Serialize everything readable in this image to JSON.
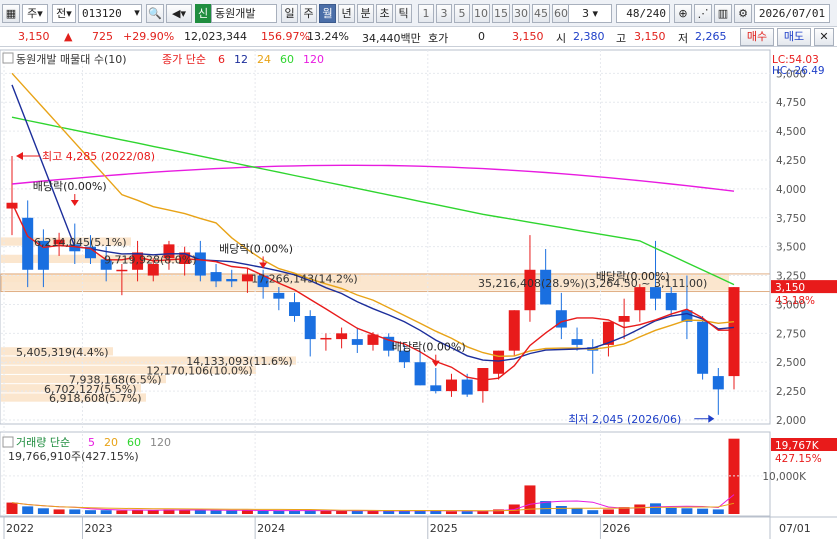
{
  "toolbar": {
    "chart_type_label": "주",
    "period_label": "전",
    "code": "013120",
    "badge": "신",
    "stock_name": "동원개발",
    "periods": [
      "일",
      "주",
      "월",
      "년",
      "분",
      "초",
      "틱"
    ],
    "active_period": "월",
    "intervals": [
      "1",
      "3",
      "5",
      "10",
      "15",
      "30",
      "45",
      "60"
    ],
    "interval_select": "3",
    "count": "48/240",
    "date": "2026/07/01"
  },
  "quote": {
    "price": "3,150",
    "change": "725",
    "change_pct": "+29.90%",
    "volume": "12,023,344",
    "vol_ratio": "156.97%",
    "turnover": "13.24%",
    "amount": "34,440백만",
    "hoga_label": "호가",
    "hoga_value": "0",
    "hoga_price": "3,150",
    "open_label": "시",
    "open": "2,380",
    "high_label": "고",
    "high": "3,150",
    "low_label": "저",
    "low": "2,265",
    "buy_label": "매수",
    "sell_label": "매도"
  },
  "price_panel": {
    "series_label": "동원개발 매물대 수(10)",
    "ma_label": "종가 단순",
    "ma_periods": [
      "6",
      "12",
      "24",
      "60",
      "120"
    ],
    "ma_colors": [
      "#e81b1b",
      "#1c2e9b",
      "#e8a317",
      "#2fd52f",
      "#e81be0"
    ],
    "lc": "LC:54.03",
    "hc": "HC:-26.49",
    "current_price_tag": "3,150",
    "current_pct_tag": "43.18%",
    "high_annotation": "최고 4,285 (2022/08)",
    "low_annotation": "최저 2,045 (2026/06)",
    "dividend_label": "배당락(0.00%)",
    "yticks": [
      "5,000",
      "4,750",
      "4,500",
      "4,250",
      "4,000",
      "3,750",
      "3,500",
      "3,250",
      "3,000",
      "2,750",
      "2,500",
      "2,250",
      "2,000"
    ],
    "volume_profile": [
      {
        "label": "6,918,608(5.7%)",
        "lo": 2150,
        "hi": 2230,
        "len": 145
      },
      {
        "label": "6,702,127(5.5%)",
        "lo": 2230,
        "hi": 2310,
        "len": 140
      },
      {
        "label": "7,938,168(6.5%)",
        "lo": 2310,
        "hi": 2390,
        "len": 165
      },
      {
        "label": "12,170,106(10.0%)",
        "lo": 2390,
        "hi": 2470,
        "len": 255
      },
      {
        "label": "14,133,093(11.6%)",
        "lo": 2470,
        "hi": 2550,
        "len": 295
      },
      {
        "label": "5,405,319(4.4%)",
        "lo": 2550,
        "hi": 2630,
        "len": 112
      },
      {
        "label": "35,216,408(28.9%)(3,264.50 ~ 3,111.00)",
        "lo": 3111,
        "hi": 3264,
        "len": 728
      },
      {
        "label": "17,266,143(14.2%)",
        "lo": 3185,
        "hi": 3264,
        "len": 360
      },
      {
        "label": "9,719,928(8.0%)",
        "lo": 3350,
        "hi": 3430,
        "len": 200
      },
      {
        "label": "6,214,045(5.1%)",
        "lo": 3500,
        "hi": 3580,
        "len": 130
      }
    ]
  },
  "volume_panel": {
    "label": "거래량 단순",
    "ma_periods": [
      "5",
      "20",
      "60",
      "120"
    ],
    "ma_colors": [
      "#e81be0",
      "#e8a317",
      "#2fd52f",
      "#888888"
    ],
    "summary": "19,766,910주(427.15%)",
    "tag_value": "19,767K",
    "tag_pct": "427.15%",
    "ytick": "10,000K"
  },
  "x_axis": {
    "labels": [
      {
        "text": "2022",
        "i": 0
      },
      {
        "text": "2023",
        "i": 5
      },
      {
        "text": "2024",
        "i": 16
      },
      {
        "text": "2025",
        "i": 27
      },
      {
        "text": "2026",
        "i": 38
      }
    ],
    "end_label": "07/01"
  },
  "chart_data": {
    "type": "candlestick",
    "ylim": [
      2000,
      5000
    ],
    "candles": [
      [
        3830,
        4285,
        3600,
        3880
      ],
      [
        3750,
        3900,
        3150,
        3300
      ],
      [
        3550,
        3650,
        3150,
        3300
      ],
      [
        3520,
        3620,
        3420,
        3560
      ],
      [
        3520,
        3700,
        3350,
        3460
      ],
      [
        3500,
        3600,
        3350,
        3400
      ],
      [
        3390,
        3500,
        3200,
        3300
      ],
      [
        3300,
        3350,
        3080,
        3300
      ],
      [
        3300,
        3550,
        3200,
        3450
      ],
      [
        3250,
        3400,
        3200,
        3350
      ],
      [
        3400,
        3550,
        3300,
        3520
      ],
      [
        3350,
        3500,
        3250,
        3450
      ],
      [
        3450,
        3550,
        3200,
        3250
      ],
      [
        3280,
        3350,
        3150,
        3200
      ],
      [
        3220,
        3300,
        3150,
        3200
      ],
      [
        3200,
        3320,
        3100,
        3260
      ],
      [
        3250,
        3300,
        3050,
        3150
      ],
      [
        3100,
        3150,
        2950,
        3050
      ],
      [
        3020,
        3100,
        2850,
        2900
      ],
      [
        2900,
        2950,
        2550,
        2700
      ],
      [
        2700,
        2750,
        2600,
        2710
      ],
      [
        2700,
        2800,
        2620,
        2750
      ],
      [
        2700,
        2800,
        2580,
        2650
      ],
      [
        2650,
        2760,
        2600,
        2740
      ],
      [
        2720,
        2750,
        2550,
        2600
      ],
      [
        2600,
        2650,
        2450,
        2500
      ],
      [
        2500,
        2600,
        2300,
        2300
      ],
      [
        2300,
        2450,
        2230,
        2250
      ],
      [
        2250,
        2400,
        2200,
        2350
      ],
      [
        2350,
        2400,
        2200,
        2220
      ],
      [
        2250,
        2400,
        2150,
        2450
      ],
      [
        2400,
        2600,
        2350,
        2600
      ],
      [
        2600,
        2950,
        2550,
        2950
      ],
      [
        2950,
        3600,
        2850,
        3300
      ],
      [
        3300,
        3480,
        3000,
        3000
      ],
      [
        2950,
        3100,
        2700,
        2800
      ],
      [
        2700,
        2800,
        2600,
        2650
      ],
      [
        2630,
        2700,
        2400,
        2600
      ],
      [
        2650,
        2850,
        2550,
        2850
      ],
      [
        2850,
        3050,
        2700,
        2900
      ],
      [
        2950,
        3100,
        2850,
        3150
      ],
      [
        3150,
        3550,
        2950,
        3050
      ],
      [
        3100,
        3150,
        2900,
        2950
      ],
      [
        2950,
        3250,
        2700,
        2850
      ],
      [
        2850,
        2900,
        2350,
        2400
      ],
      [
        2380,
        2450,
        2045,
        2265
      ],
      [
        2380,
        3150,
        2265,
        3150
      ]
    ],
    "volume": [
      3,
      2,
      1.5,
      1.2,
      1.2,
      1,
      1,
      0.9,
      1.1,
      1,
      1.2,
      1,
      1,
      0.9,
      0.9,
      1,
      0.8,
      0.9,
      0.8,
      1,
      0.9,
      0.8,
      0.8,
      0.8,
      0.8,
      0.9,
      1,
      0.8,
      0.7,
      0.7,
      0.8,
      1.2,
      2.5,
      7.5,
      3.4,
      2.1,
      1.5,
      1,
      1.2,
      1.8,
      2.5,
      2.8,
      1.6,
      1.5,
      1.4,
      1.2,
      19.77
    ]
  }
}
